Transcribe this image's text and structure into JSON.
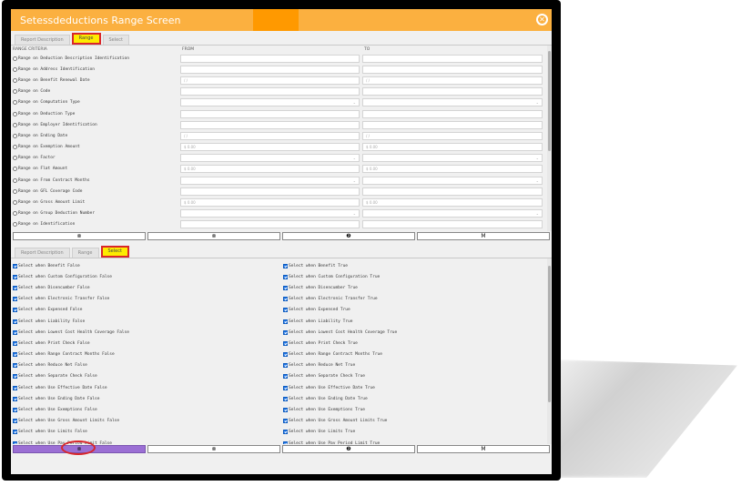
{
  "window": {
    "title": "Setessdeductions Range Screen"
  },
  "top_tabs": [
    "Report Description",
    "Range",
    "Select"
  ],
  "range": {
    "col_criteria": "RANGE CRITERIA",
    "col_from": "FROM",
    "col_to": "TO",
    "rows": [
      {
        "label": "Range on Deduction Description Identification",
        "from": "",
        "to": ""
      },
      {
        "label": "Range on Address Identification",
        "from": "",
        "to": ""
      },
      {
        "label": "Range on Benefit Renewal Date",
        "from": "/ /",
        "to": "/ /"
      },
      {
        "label": "Range on Code",
        "from": "",
        "to": ""
      },
      {
        "label": "Range on Computation Type",
        "from": "",
        "to": "",
        "dropdown": true
      },
      {
        "label": "Range on Deduction Type",
        "from": "",
        "to": ""
      },
      {
        "label": "Range on Employer Identification",
        "from": "",
        "to": ""
      },
      {
        "label": "Range on Ending Date",
        "from": "/ /",
        "to": "/ /"
      },
      {
        "label": "Range on Exemption Amount",
        "from": "$ 0.00",
        "to": "$ 0.00"
      },
      {
        "label": "Range on Factor",
        "from": "",
        "to": "",
        "dropdown": true
      },
      {
        "label": "Range on Flat Amount",
        "from": "$ 0.00",
        "to": "$ 0.00"
      },
      {
        "label": "Range on From Contract Months",
        "from": "",
        "to": "",
        "dropdown": true
      },
      {
        "label": "Range on GFL Coverage Code",
        "from": "",
        "to": ""
      },
      {
        "label": "Range on Gross Amount Limit",
        "from": "$ 0.00",
        "to": "$ 0.00"
      },
      {
        "label": "Range on Group Deduction Number",
        "from": "",
        "to": "",
        "dropdown": true
      },
      {
        "label": "Range on Identification",
        "from": "",
        "to": ""
      }
    ]
  },
  "buttons": [
    "⊗",
    "⊗",
    "❷",
    "Ⅿ"
  ],
  "bottom_tabs": [
    "Report Description",
    "Range",
    "Select"
  ],
  "select": {
    "left": [
      "Select when Benefit False",
      "Select when Custom Configuration False",
      "Select when Disencumber False",
      "Select when Electronic Transfer False",
      "Select when Expensed False",
      "Select when Liability False",
      "Select when Lowest Cost Health Coverage False",
      "Select when Print Check False",
      "Select when Range Contract Months False",
      "Select when Reduce Net False",
      "Select when Separate Check False",
      "Select when Use Effective Date False",
      "Select when Use Ending Date False",
      "Select when Use Exemptions False",
      "Select when Use Gross Amount Limits False",
      "Select when Use Limits False",
      "Select when Use Pay Period Limit False"
    ],
    "right": [
      "Select when Benefit True",
      "Select when Custom Configuration True",
      "Select when Disencumber True",
      "Select when Electronic Transfer True",
      "Select when Expensed True",
      "Select when Liability True",
      "Select when Lowest Cost Health Coverage True",
      "Select when Print Check True",
      "Select when Range Contract Months True",
      "Select when Reduce Net True",
      "Select when Separate Check True",
      "Select when Use Effective Date True",
      "Select when Use Ending Date True",
      "Select when Use Exemptions True",
      "Select when Use Gross Amount Limits True",
      "Select when Use Limits True",
      "Select when Use Pay Period Limit True"
    ]
  },
  "colors": {
    "titlebar": "#fbb040",
    "highlight_tab": "#fdeb00",
    "annotation_red": "#d9262a",
    "primary_button": "#9b6fd4"
  }
}
